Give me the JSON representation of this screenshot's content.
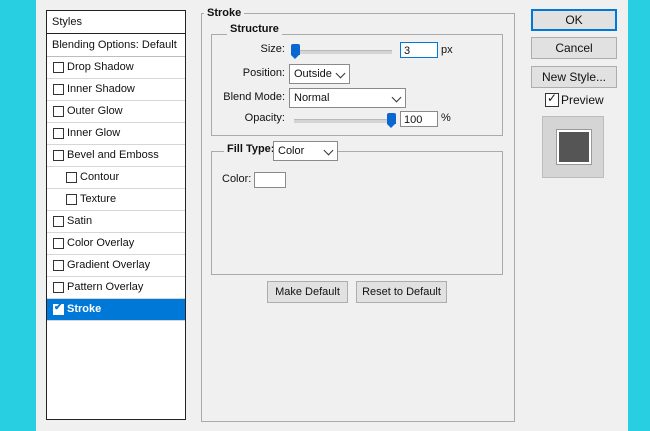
{
  "styles_panel": {
    "header": "Styles",
    "blending_options": "Blending Options: Default",
    "items": [
      {
        "label": "Drop Shadow",
        "checked": false
      },
      {
        "label": "Inner Shadow",
        "checked": false
      },
      {
        "label": "Outer Glow",
        "checked": false
      },
      {
        "label": "Inner Glow",
        "checked": false
      },
      {
        "label": "Bevel and Emboss",
        "checked": false
      },
      {
        "label": "Contour",
        "checked": false
      },
      {
        "label": "Texture",
        "checked": false
      },
      {
        "label": "Satin",
        "checked": false
      },
      {
        "label": "Color Overlay",
        "checked": false
      },
      {
        "label": "Gradient Overlay",
        "checked": false
      },
      {
        "label": "Pattern Overlay",
        "checked": false
      },
      {
        "label": "Stroke",
        "checked": true,
        "selected": true
      }
    ]
  },
  "stroke": {
    "title": "Stroke",
    "structure": {
      "title": "Structure",
      "size_label": "Size:",
      "size_value": "3",
      "size_unit": "px",
      "size_slider_fraction": 0.0,
      "position_label": "Position:",
      "position_value": "Outside",
      "blend_mode_label": "Blend Mode:",
      "blend_mode_value": "Normal",
      "opacity_label": "Opacity:",
      "opacity_value": "100",
      "opacity_unit": "%",
      "opacity_slider_fraction": 1.0
    },
    "fill": {
      "fill_type_label": "Fill Type:",
      "fill_type_value": "Color",
      "color_label": "Color:",
      "color_value": "#ffffff"
    },
    "make_default": "Make Default",
    "reset_to_default": "Reset to Default"
  },
  "actions": {
    "ok": "OK",
    "cancel": "Cancel",
    "new_style": "New Style...",
    "preview_label": "Preview",
    "preview_checked": true,
    "preview_color": "#555555"
  },
  "colors": {
    "selection": "#0078d7",
    "background_accent": "#27cfe0"
  }
}
